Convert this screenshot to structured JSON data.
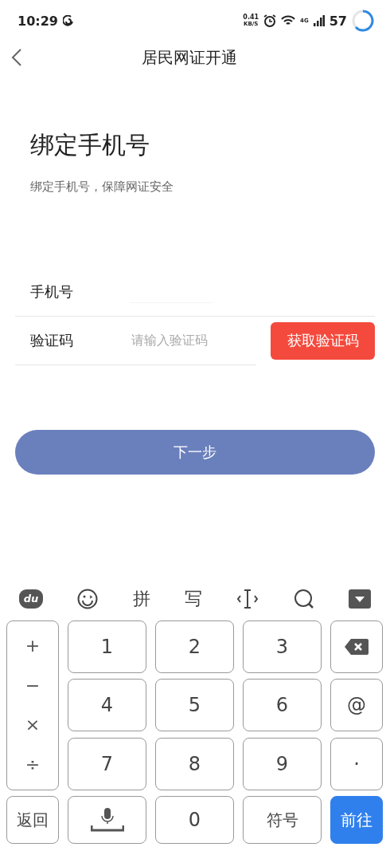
{
  "status_bar": {
    "time": "10:29",
    "net_speed": "0.41",
    "net_unit": "KB/S",
    "network": "4G",
    "battery": "57"
  },
  "nav": {
    "title": "居民网证开通"
  },
  "heading": "绑定手机号",
  "subtitle": "绑定手机号，保障网证安全",
  "form": {
    "phone_label": "手机号",
    "code_label": "验证码",
    "code_placeholder": "请输入验证码",
    "get_code_button": "获取验证码"
  },
  "next_button": "下一步",
  "keyboard": {
    "logo": "du",
    "toolbar": [
      "拼",
      "写"
    ],
    "operators": [
      "+",
      "−",
      "×",
      "÷"
    ],
    "keys": [
      {
        "kind": "text",
        "label": "1"
      },
      {
        "kind": "text",
        "label": "2"
      },
      {
        "kind": "text",
        "label": "3"
      },
      {
        "kind": "delete"
      },
      {
        "kind": "text",
        "label": "4"
      },
      {
        "kind": "text",
        "label": "5"
      },
      {
        "kind": "text",
        "label": "6"
      },
      {
        "kind": "text",
        "label": "@"
      },
      {
        "kind": "text",
        "label": "7"
      },
      {
        "kind": "text",
        "label": "8"
      },
      {
        "kind": "text",
        "label": "9"
      },
      {
        "kind": "text",
        "label": "·"
      }
    ],
    "bottom": [
      {
        "kind": "text",
        "label": "返回"
      },
      {
        "kind": "voice"
      },
      {
        "kind": "text",
        "label": "0"
      },
      {
        "kind": "text",
        "label": "符号"
      },
      {
        "kind": "primary",
        "label": "前往"
      }
    ]
  }
}
